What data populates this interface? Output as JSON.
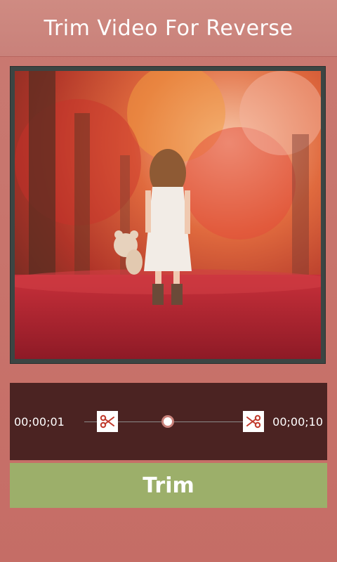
{
  "header": {
    "title": "Trim Video For Reverse"
  },
  "preview": {
    "image": "girl-with-teddy-bear-autumn-forest"
  },
  "trim": {
    "start_time": "00;00;01",
    "end_time": "00;00;10",
    "start_icon": "scissors-icon",
    "end_icon": "scissors-icon"
  },
  "actions": {
    "trim_label": "Trim"
  },
  "colors": {
    "background": "#c8736b",
    "header": "#cf8b82",
    "panel": "#4b2322",
    "trim_button": "#9caf6a",
    "accent": "#c9817a"
  }
}
